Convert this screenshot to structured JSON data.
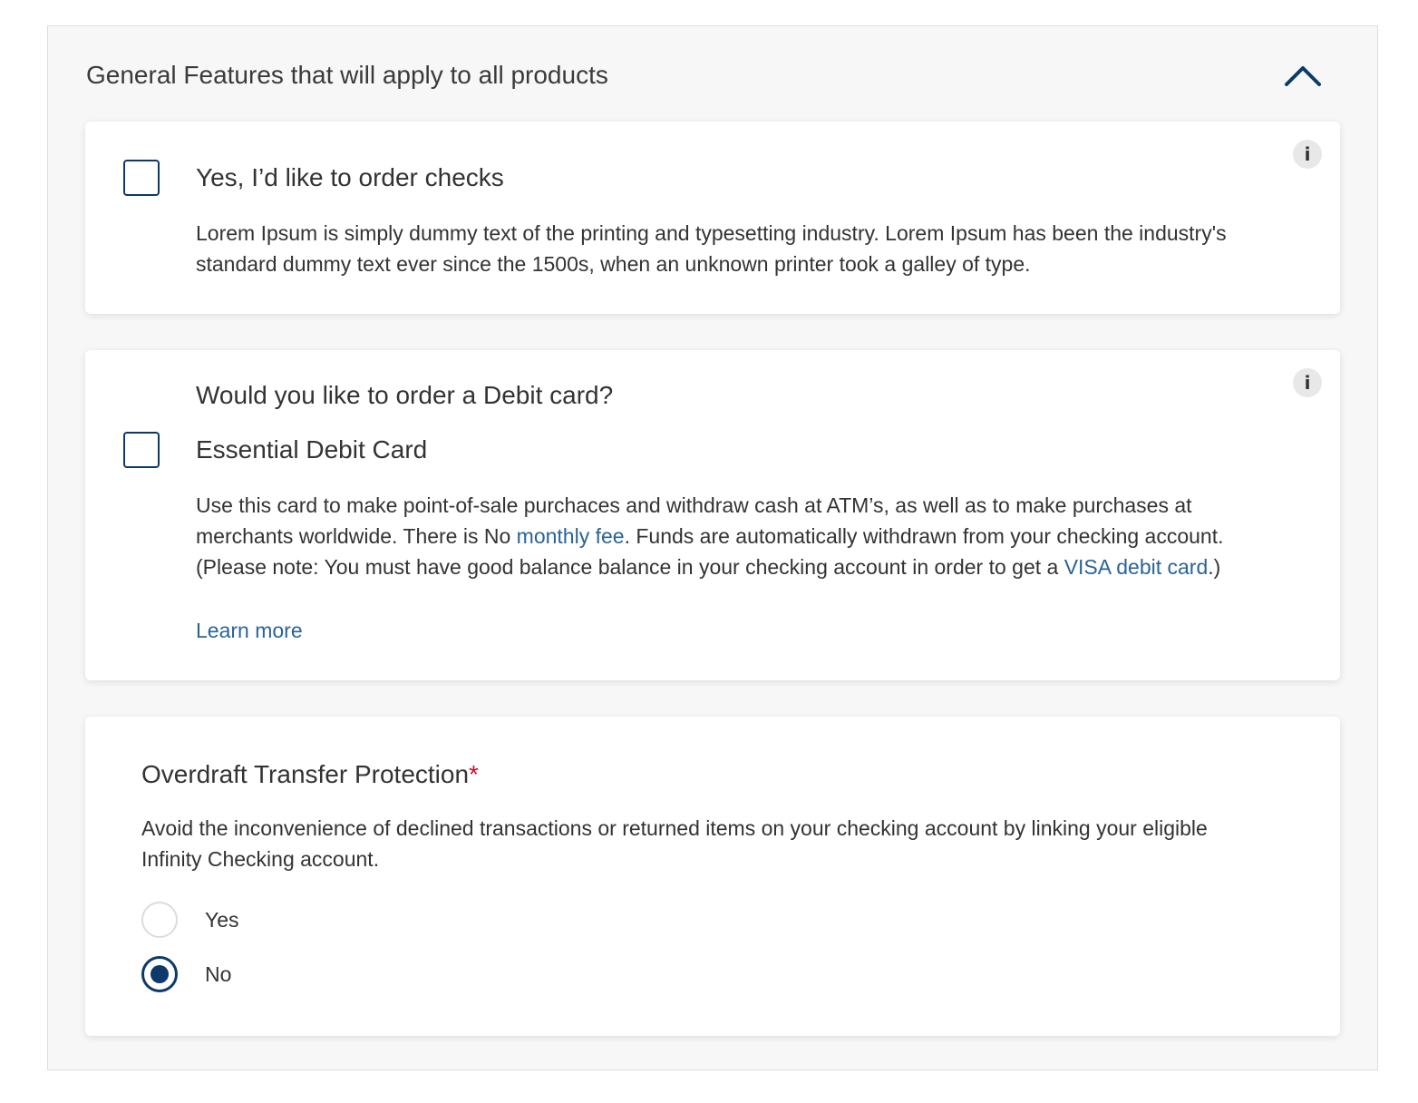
{
  "panel": {
    "title": "General Features that will apply to all products"
  },
  "checks": {
    "label": "Yes, I’d like to order checks",
    "description": "Lorem Ipsum is simply dummy text of the printing and typesetting industry. Lorem Ipsum has been the industry's standard dummy text ever since the 1500s, when an unknown printer took a galley of type.",
    "info_label": "i"
  },
  "debit": {
    "question": "Would you like to order a Debit card?",
    "label": "Essential Debit Card",
    "description_part1": "Use this card to make point-of-sale purchaces and withdraw cash at ATM’s, as well as to make purchases at merchants worldwide. There is No ",
    "link_monthly_fee": "monthly fee",
    "description_part2": ". Funds are automatically withdrawn from your checking account. (Please note: You must have good balance balance in your checking account in order to get a ",
    "link_visa": "VISA debit card",
    "description_part3": ".)",
    "learn_more": "Learn more",
    "info_label": "i"
  },
  "overdraft": {
    "title": "Overdraft Transfer Protection",
    "required_mark": "*",
    "description": "Avoid the inconvenience of declined transactions or returned items on your checking account by linking your eligible Infinity Checking account.",
    "options": [
      {
        "label": "Yes",
        "selected": false
      },
      {
        "label": "No",
        "selected": true
      }
    ]
  },
  "colors": {
    "primary": "#0d3a6a",
    "link": "#2a6496",
    "required": "#c8102e",
    "panel_bg": "#f7f7f7"
  },
  "icons": {
    "collapse": "chevron-up-icon",
    "info": "info-icon"
  }
}
